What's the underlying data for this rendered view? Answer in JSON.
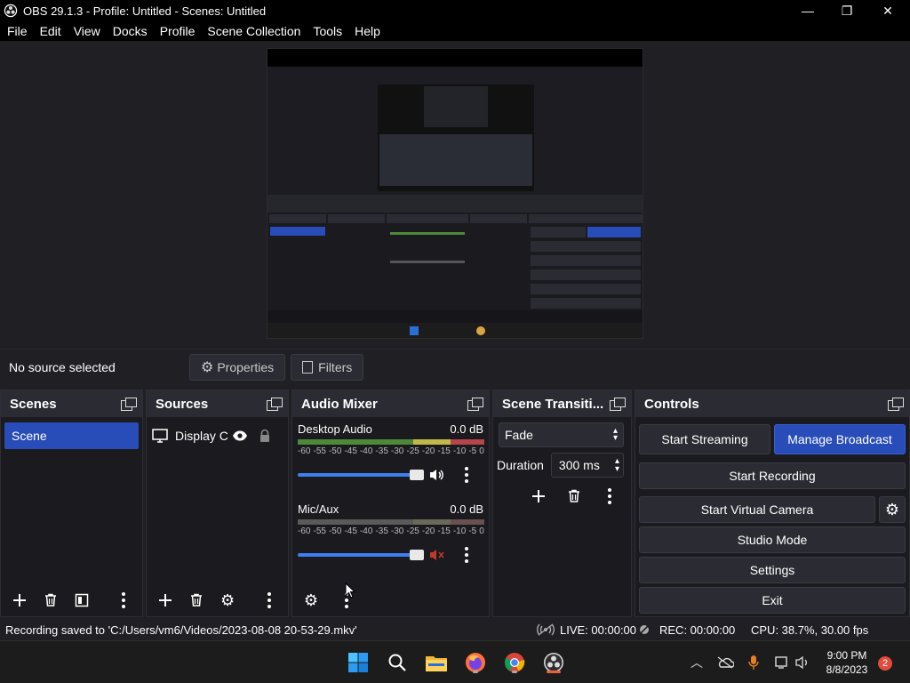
{
  "window": {
    "title": "OBS 29.1.3 - Profile: Untitled - Scenes: Untitled",
    "minimize": "—",
    "maximize": "❐",
    "close": "✕"
  },
  "menu": [
    "File",
    "Edit",
    "View",
    "Docks",
    "Profile",
    "Scene Collection",
    "Tools",
    "Help"
  ],
  "source_bar": {
    "status": "No source selected",
    "properties_label": "Properties",
    "filters_label": "Filters"
  },
  "scenes": {
    "title": "Scenes",
    "items": [
      "Scene"
    ]
  },
  "sources": {
    "title": "Sources",
    "items": [
      "Display Ca"
    ]
  },
  "mixer": {
    "title": "Audio Mixer",
    "channels": [
      {
        "name": "Desktop Audio",
        "level": "0.0 dB",
        "muted": false
      },
      {
        "name": "Mic/Aux",
        "level": "0.0 dB",
        "muted": true
      }
    ],
    "ticks": [
      "-60",
      "-55",
      "-50",
      "-45",
      "-40",
      "-35",
      "-30",
      "-25",
      "-20",
      "-15",
      "-10",
      "-5",
      "0"
    ]
  },
  "transitions": {
    "title": "Scene Transiti...",
    "selected": "Fade",
    "duration_label": "Duration",
    "duration_value": "300 ms"
  },
  "controls": {
    "title": "Controls",
    "start_streaming": "Start Streaming",
    "manage_broadcast": "Manage Broadcast",
    "start_recording": "Start Recording",
    "start_virtual_camera": "Start Virtual Camera",
    "studio_mode": "Studio Mode",
    "settings": "Settings",
    "exit": "Exit"
  },
  "status": {
    "message": "Recording saved to 'C:/Users/vm6/Videos/2023-08-08 20-53-29.mkv'",
    "live": "LIVE: 00:00:00",
    "rec": "REC: 00:00:00",
    "cpu": "CPU: 38.7%, 30.00 fps"
  },
  "taskbar": {
    "time": "9:00 PM",
    "date": "8/8/2023",
    "notifications": "2"
  },
  "colors": {
    "accent": "#284cb8",
    "slider": "#3d7ff1",
    "mute_red": "#c0392b"
  }
}
